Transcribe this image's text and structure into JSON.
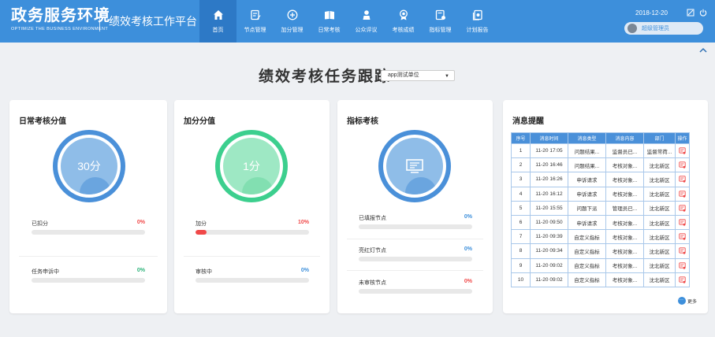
{
  "header": {
    "brand_cn": "政务服务环境",
    "brand_en": "OPTIMIZE THE BUSINESS ENVIRONMENT",
    "platform": "绩效考核工作平台",
    "date": "2018-12-20",
    "user": "超级管理员",
    "nav": [
      {
        "label": "首页",
        "icon": "home-icon",
        "active": true
      },
      {
        "label": "节点管理",
        "icon": "edit-icon"
      },
      {
        "label": "加分管理",
        "icon": "plus-circle-icon"
      },
      {
        "label": "日常考核",
        "icon": "book-icon"
      },
      {
        "label": "公众评议",
        "icon": "person-icon"
      },
      {
        "label": "考核成绩",
        "icon": "medal-icon"
      },
      {
        "label": "指标管理",
        "icon": "settings-doc-icon"
      },
      {
        "label": "计划报告",
        "icon": "report-icon"
      }
    ]
  },
  "page": {
    "title": "绩效考核任务跟踪",
    "unit_select": "app测试单位"
  },
  "daily": {
    "title": "日常考核分值",
    "value": "30分",
    "deducted_label": "已扣分",
    "deducted_pct": "0%",
    "deducted_fraction": 0,
    "appeal_label": "任务申诉中",
    "appeal_pct": "0%",
    "appeal_fraction": 0
  },
  "bonus": {
    "title": "加分分值",
    "value": "1分",
    "added_label": "加分",
    "added_pct": "10%",
    "added_fraction": 0.1,
    "review_label": "审核中",
    "review_pct": "0%",
    "review_fraction": 0
  },
  "indicator": {
    "title": "指标考核",
    "filled_label": "已填报节点",
    "filled_pct": "0%",
    "filled_fraction": 0,
    "redlight_label": "亮红灯节点",
    "redlight_pct": "0%",
    "redlight_fraction": 0,
    "unreviewed_label": "未审核节点",
    "unreviewed_pct": "0%",
    "unreviewed_fraction": 0
  },
  "messages": {
    "title": "消息提醒",
    "columns": [
      "序号",
      "消息时间",
      "消息类型",
      "消息内容",
      "部门",
      "操作"
    ],
    "rows": [
      [
        "1",
        "11-20 17:05",
        "问题结果...",
        "监督员已...",
        "监督常荷...",
        ""
      ],
      [
        "2",
        "11-20 16:46",
        "问题结果...",
        "考核对象...",
        "沈北新区",
        ""
      ],
      [
        "3",
        "11-20 16:26",
        "申诉请求",
        "考核对象...",
        "沈北新区",
        ""
      ],
      [
        "4",
        "11-20 16:12",
        "申诉请求",
        "考核对象...",
        "沈北新区",
        ""
      ],
      [
        "5",
        "11-20 15:55",
        "问题下派",
        "管理员已...",
        "沈北新区",
        ""
      ],
      [
        "6",
        "11-20 09:50",
        "申诉请求",
        "考核对象...",
        "沈北新区",
        ""
      ],
      [
        "7",
        "11-20 09:39",
        "自定义指标",
        "考核对象...",
        "沈北新区",
        ""
      ],
      [
        "8",
        "11-20 09:34",
        "自定义指标",
        "考核对象...",
        "沈北新区",
        ""
      ],
      [
        "9",
        "11-20 09:02",
        "自定义指标",
        "考核对象...",
        "沈北新区",
        ""
      ],
      [
        "10",
        "11-20 09:02",
        "自定义指标",
        "考核对象...",
        "沈北新区",
        ""
      ]
    ],
    "more": "更多"
  },
  "colors": {
    "header_blue": "#3d8fdb",
    "nav_active": "#2d79c6",
    "ring_blue": "#4a90d9",
    "ring_green": "#3ccf8e",
    "alert_red": "#f04848",
    "ok_green": "#2db37a"
  }
}
